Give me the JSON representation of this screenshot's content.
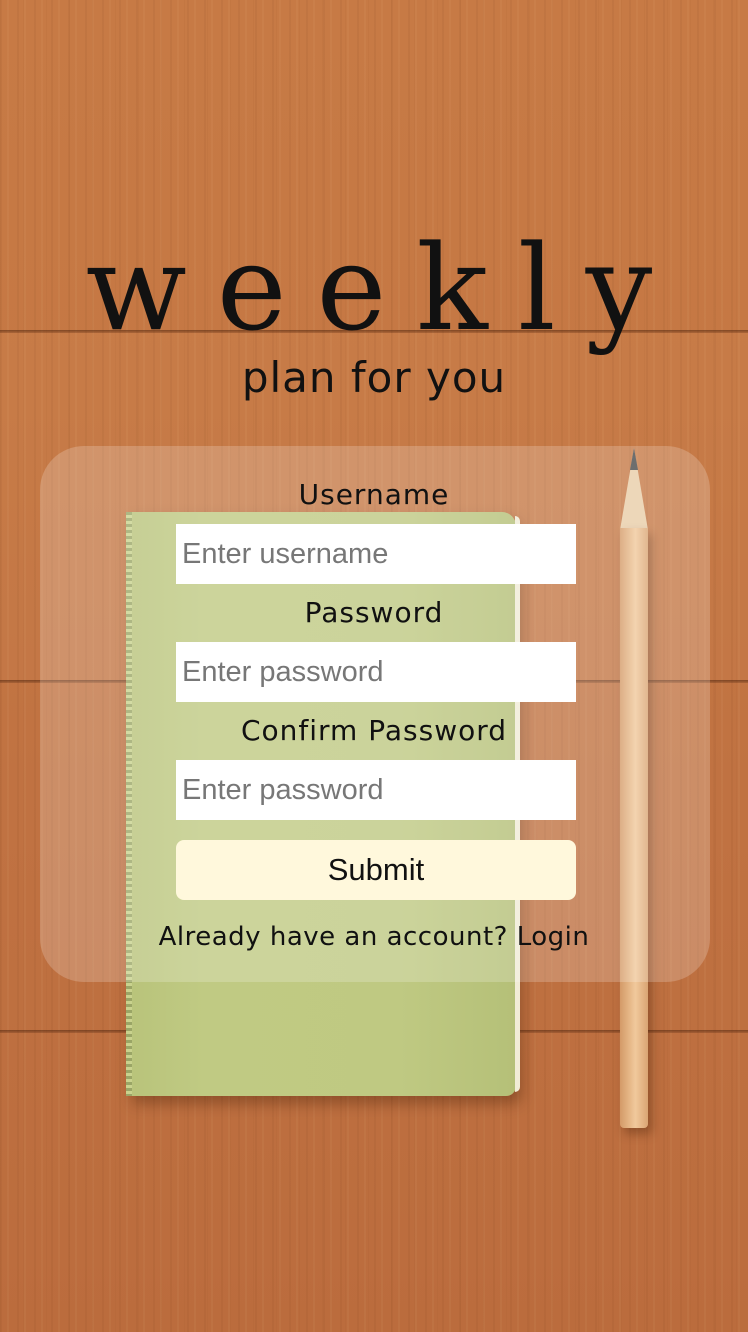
{
  "app": {
    "logo_text": "weekly",
    "tagline": "plan for you"
  },
  "form": {
    "username": {
      "label": "Username",
      "placeholder": "Enter username",
      "value": ""
    },
    "password": {
      "label": "Password",
      "placeholder": "Enter password",
      "value": ""
    },
    "confirm_password": {
      "label": "Confirm Password",
      "placeholder": "Enter password",
      "value": ""
    },
    "submit_label": "Submit",
    "account_prompt": "Already have an account?",
    "login_link": "Login"
  },
  "colors": {
    "submit_background": "#fff8dc",
    "input_background": "#ffffff",
    "text": "#111111"
  }
}
